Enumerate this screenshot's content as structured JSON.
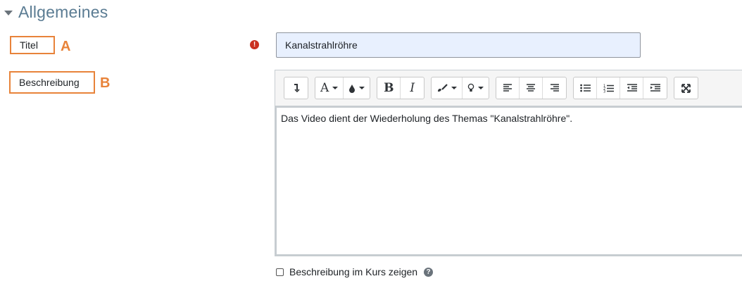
{
  "section": {
    "title": "Allgemeines"
  },
  "title_field": {
    "label": "Titel",
    "marker": "A",
    "required_symbol": "!",
    "value": "Kanalstrahlröhre"
  },
  "description_field": {
    "label": "Beschreibung",
    "marker": "B",
    "content": "Das Video dient der Wiederholung des Themas \"Kanalstrahlröhre\"."
  },
  "toolbar": {
    "groups": [
      [
        {
          "name": "toolbar-toggle-icon",
          "glyph": "↴"
        }
      ],
      [
        {
          "name": "font-style-icon",
          "glyph": "A",
          "dropdown": true
        },
        {
          "name": "text-color-icon",
          "glyph": "●",
          "dropdown": true
        }
      ],
      [
        {
          "name": "bold-icon",
          "glyph": "B"
        },
        {
          "name": "italic-icon",
          "glyph": "I"
        }
      ],
      [
        {
          "name": "paint-brush-icon",
          "glyph": "🖌",
          "dropdown": true
        },
        {
          "name": "lightbulb-icon",
          "glyph": "♀",
          "dropdown": true
        }
      ],
      [
        {
          "name": "align-left-icon",
          "glyph": "≡"
        },
        {
          "name": "align-center-icon",
          "glyph": "≡"
        },
        {
          "name": "align-right-icon",
          "glyph": "≡"
        }
      ],
      [
        {
          "name": "unordered-list-icon",
          "glyph": "☰"
        },
        {
          "name": "ordered-list-icon",
          "glyph": "☰"
        },
        {
          "name": "outdent-icon",
          "glyph": "⇤"
        },
        {
          "name": "indent-icon",
          "glyph": "⇥"
        }
      ],
      [
        {
          "name": "fullscreen-icon",
          "glyph": "⤧"
        }
      ]
    ]
  },
  "show_in_course": {
    "label": "Beschreibung im Kurs zeigen",
    "checked": false,
    "help_symbol": "?"
  },
  "colors": {
    "accent_marker": "#e8833a",
    "section_title": "#5b7c93",
    "required": "#ca3120",
    "input_autofill_bg": "#e8f0fe"
  }
}
